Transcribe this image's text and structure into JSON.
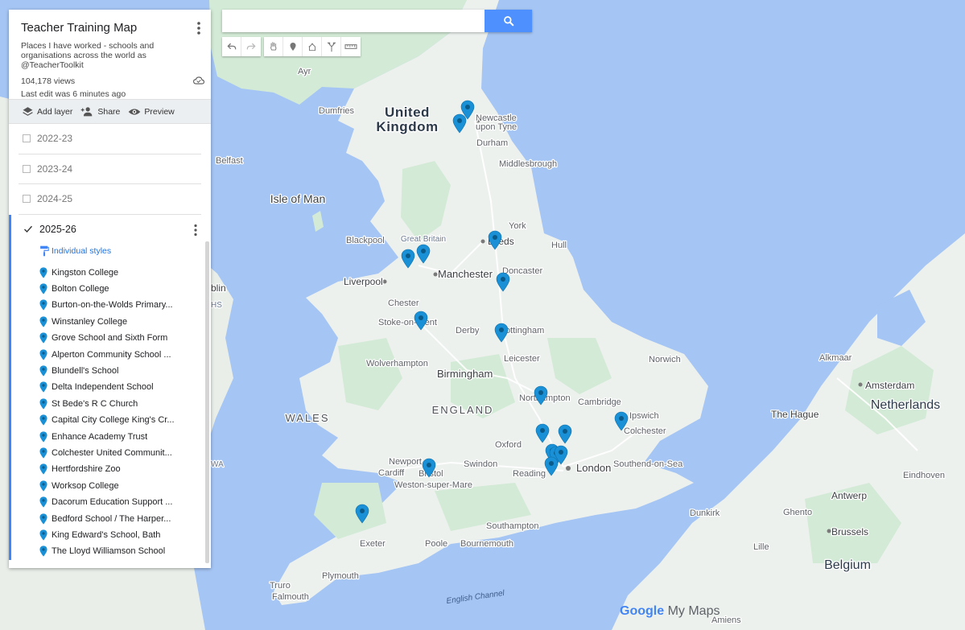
{
  "panel": {
    "title": "Teacher Training Map",
    "description": "Places I have worked - schools and organisations across the world as @TeacherToolkit",
    "views": "104,178 views",
    "last_edit": "Last edit was 6 minutes ago",
    "actions": {
      "add_layer": "Add layer",
      "share": "Share",
      "preview": "Preview"
    },
    "layers": [
      {
        "name": "2022-23",
        "checked": false
      },
      {
        "name": "2023-24",
        "checked": false
      },
      {
        "name": "2024-25",
        "checked": false
      }
    ],
    "active_layer": {
      "name": "2025-26",
      "checked": true,
      "style_label": "Individual styles",
      "places": [
        "Kingston College",
        "Bolton College",
        "Burton-on-the-Wolds Primary...",
        "Winstanley College",
        "Grove School and Sixth Form",
        "Alperton Community School ...",
        "Blundell's School",
        "Delta Independent School",
        "St Bede's R C Church",
        "Capital City College King's Cr...",
        "Enhance Academy Trust",
        "Colchester United Communit...",
        "Hertfordshire Zoo",
        "Worksop College",
        "Dacorum Education Support ...",
        "Bedford School / The Harper...",
        "King Edward's School, Bath",
        "The Lloyd Williamson School"
      ]
    }
  },
  "search": {
    "placeholder": "",
    "value": ""
  },
  "map_labels": {
    "uk1": "United",
    "uk2": "Kingdom",
    "gb": "Great Britain",
    "isle_of_man": "Isle of Man",
    "wales": "WALES",
    "england": "ENGLAND",
    "netherlands": "Netherlands",
    "belgium": "Belgium",
    "newcastle1": "Newcastle",
    "newcastle2": "upon Tyne",
    "durham": "Durham",
    "middlesbrough": "Middlesbrough",
    "dumfries": "Dumfries",
    "belfast": "Belfast",
    "blackpool": "Blackpool",
    "leeds": "Leeds",
    "york": "York",
    "hull": "Hull",
    "doncaster": "Doncaster",
    "liverpool": "Liverpool",
    "manchester": "Manchester",
    "chester": "Chester",
    "stoke": "Stoke-on-Trent",
    "derby": "Derby",
    "nottingham": "Nottingham",
    "wolverhampton": "Wolverhampton",
    "birmingham": "Birmingham",
    "leicester": "Leicester",
    "norwich": "Norwich",
    "northampton": "Northampton",
    "cambridge": "Cambridge",
    "ipswich": "Ipswich",
    "colchester": "Colchester",
    "oxford": "Oxford",
    "newport": "Newport",
    "cardiff": "Cardiff",
    "bristol": "Bristol",
    "swindon": "Swindon",
    "wsm": "Weston-super-Mare",
    "reading": "Reading",
    "london": "London",
    "southend": "Southend-on-Sea",
    "southampton": "Southampton",
    "poole": "Poole",
    "bournemouth": "Bournemouth",
    "exeter": "Exeter",
    "plymouth": "Plymouth",
    "truro": "Truro",
    "falmouth": "Falmouth",
    "english_channel": "English Channel",
    "the_hague": "The Hague",
    "amsterdam": "Amsterdam",
    "alkmaar": "Alkmaar",
    "eindhoven": "Eindhoven",
    "antwerp": "Antwerp",
    "ghent": "Ghento",
    "brussels": "Brussels",
    "dunkirk": "Dunkirk",
    "lille": "Lille",
    "amiens": "Amiens",
    "dublin": "blin",
    "ayr": "Ayr",
    "hs": "HS",
    "wa": "WA",
    "logo_google": "Google",
    "logo_mymaps": "My Maps"
  },
  "colors": {
    "sea": "#a5c5f4",
    "land": "#eef0ef",
    "green": "#cfe8d2",
    "pin": "#1a90d6",
    "accent": "#4285f4",
    "search_btn": "#4d90fe"
  },
  "icons": [
    "search-icon",
    "undo-icon",
    "redo-icon",
    "hand-icon",
    "marker-icon",
    "polygon-icon",
    "route-icon",
    "ruler-icon",
    "layers-icon",
    "add-person-icon",
    "eye-icon",
    "cloud-icon",
    "more-vert-icon",
    "paint-roller-icon",
    "checkbox-icon",
    "check-icon"
  ]
}
